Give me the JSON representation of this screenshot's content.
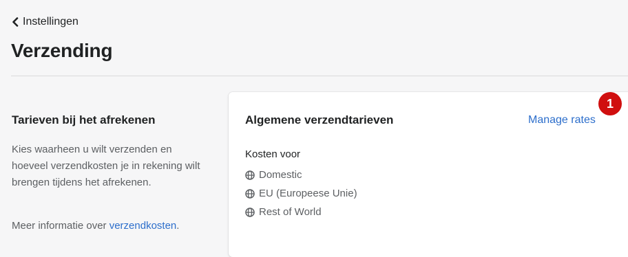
{
  "header": {
    "back_label": "Instellingen",
    "title": "Verzending"
  },
  "section": {
    "heading": "Tarieven bij het afrekenen",
    "description": "Kies waarheen u wilt verzenden en hoeveel verzendkosten je in rekening wilt brengen tijdens het afrekenen.",
    "more_prefix": "Meer informatie over ",
    "more_link": "verzendkosten",
    "more_suffix": "."
  },
  "card": {
    "title": "Algemene verzendtarieven",
    "manage_label": "Manage rates",
    "costs_label": "Kosten voor",
    "zones": [
      {
        "label": "Domestic",
        "icon": "globe-icon"
      },
      {
        "label": "EU (Europeese Unie)",
        "icon": "globe-icon"
      },
      {
        "label": "Rest of World",
        "icon": "globe-icon"
      }
    ]
  },
  "annotation": {
    "number": "1",
    "color": "#d00f0f"
  },
  "colors": {
    "background": "#f6f6f7",
    "link": "#2c6ecb",
    "text": "#202223",
    "subdued": "#5c5f62"
  }
}
